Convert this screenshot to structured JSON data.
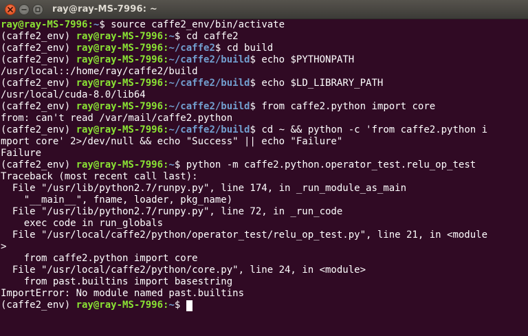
{
  "window": {
    "title": "ray@ray-MS-7996: ~"
  },
  "icons": {
    "close": "close-icon",
    "minimize": "minimize-icon",
    "maximize": "maximize-icon"
  },
  "colors": {
    "background": "#300a24",
    "user_host": "#8ae234",
    "path": "#729fcf",
    "text": "#ffffff",
    "close_button": "#df4a16"
  },
  "terminal": {
    "lines": [
      {
        "env": "",
        "user": "ray@ray-MS-7996",
        "path": "~",
        "cmd": "$ source caffe2_env/bin/activate"
      },
      {
        "env": "(caffe2_env) ",
        "user": "ray@ray-MS-7996",
        "path": "~",
        "cmd": "$ cd caffe2"
      },
      {
        "env": "(caffe2_env) ",
        "user": "ray@ray-MS-7996",
        "path": "~/caffe2",
        "cmd": "$ cd build"
      },
      {
        "env": "(caffe2_env) ",
        "user": "ray@ray-MS-7996",
        "path": "~/caffe2/build",
        "cmd": "$ echo $PYTHONPATH"
      },
      {
        "text": "/usr/local::/home/ray/caffe2/build"
      },
      {
        "env": "(caffe2_env) ",
        "user": "ray@ray-MS-7996",
        "path": "~/caffe2/build",
        "cmd": "$ echo $LD_LIBRARY_PATH"
      },
      {
        "text": "/usr/local/cuda-8.0/lib64"
      },
      {
        "env": "(caffe2_env) ",
        "user": "ray@ray-MS-7996",
        "path": "~/caffe2/build",
        "cmd": "$ from caffe2.python import core"
      },
      {
        "text": "from: can't read /var/mail/caffe2.python"
      },
      {
        "env": "(caffe2_env) ",
        "user": "ray@ray-MS-7996",
        "path": "~/caffe2/build",
        "cmd": "$ cd ~ && python -c 'from caffe2.python i"
      },
      {
        "text": "mport core' 2>/dev/null && echo \"Success\" || echo \"Failure\""
      },
      {
        "text": "Failure"
      },
      {
        "env": "(caffe2_env) ",
        "user": "ray@ray-MS-7996",
        "path": "~",
        "cmd": "$ python -m caffe2.python.operator_test.relu_op_test"
      },
      {
        "text": "Traceback (most recent call last):"
      },
      {
        "text": "  File \"/usr/lib/python2.7/runpy.py\", line 174, in _run_module_as_main"
      },
      {
        "text": "    \"__main__\", fname, loader, pkg_name)"
      },
      {
        "text": "  File \"/usr/lib/python2.7/runpy.py\", line 72, in _run_code"
      },
      {
        "text": "    exec code in run_globals"
      },
      {
        "text": "  File \"/usr/local/caffe2/python/operator_test/relu_op_test.py\", line 21, in <module"
      },
      {
        "text": ">"
      },
      {
        "text": "    from caffe2.python import core"
      },
      {
        "text": "  File \"/usr/local/caffe2/python/core.py\", line 24, in <module>"
      },
      {
        "text": "    from past.builtins import basestring"
      },
      {
        "text": "ImportError: No module named past.builtins"
      },
      {
        "env": "(caffe2_env) ",
        "user": "ray@ray-MS-7996",
        "path": "~",
        "cmd": "$ ",
        "cursor": true
      }
    ]
  }
}
